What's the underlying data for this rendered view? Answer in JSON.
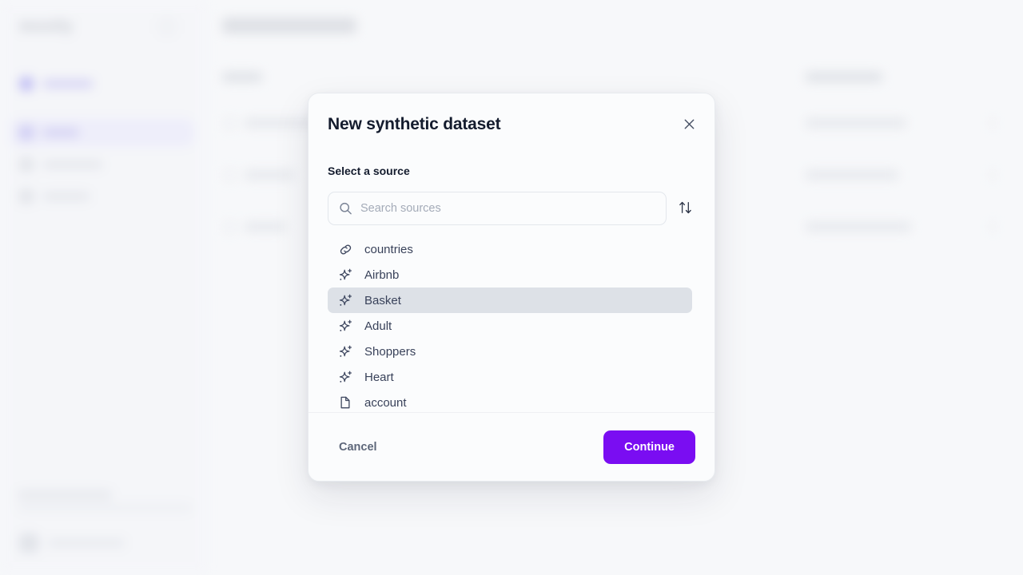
{
  "background": {
    "app_name": "mostly",
    "page_title": "Recent synthesis",
    "sidebar_items": [
      {
        "label": "Explore"
      },
      {
        "label": "Data"
      },
      {
        "label": "Workflows"
      },
      {
        "label": "Settings"
      }
    ],
    "columns": [
      "Name",
      "Last updated"
    ]
  },
  "modal": {
    "title": "New synthetic dataset",
    "close_icon": "close-icon",
    "section_label": "Select a source",
    "search": {
      "icon": "search-icon",
      "placeholder": "Search sources",
      "value": ""
    },
    "sort": {
      "icon": "sort-arrows-icon",
      "label": "Sort"
    },
    "sources": [
      {
        "label": "countries",
        "icon": "link-icon",
        "selected": false
      },
      {
        "label": "Airbnb",
        "icon": "sparkle-icon",
        "selected": false
      },
      {
        "label": "Basket",
        "icon": "sparkle-icon",
        "selected": true
      },
      {
        "label": "Adult",
        "icon": "sparkle-icon",
        "selected": false
      },
      {
        "label": "Shoppers",
        "icon": "sparkle-icon",
        "selected": false
      },
      {
        "label": "Heart",
        "icon": "sparkle-icon",
        "selected": false
      },
      {
        "label": "account",
        "icon": "file-icon",
        "selected": false
      }
    ],
    "footer": {
      "cancel_label": "Cancel",
      "continue_label": "Continue"
    }
  },
  "colors": {
    "accent": "#7a0df2",
    "page_background": "#f7f8fa",
    "modal_background": "#fbfcfd",
    "selected_row": "#dde1e7",
    "title_text": "#141c2e",
    "body_text": "#39425a"
  }
}
